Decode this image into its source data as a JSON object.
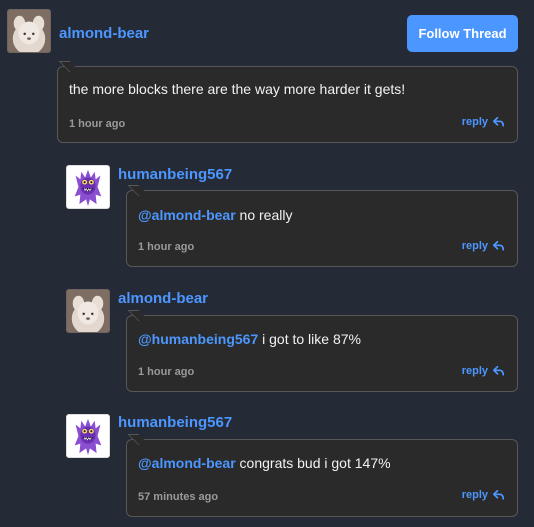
{
  "thread": {
    "follow_label": "Follow Thread"
  },
  "comments": [
    {
      "author": "almond-bear",
      "mention": "",
      "text": "the more blocks there are the way more harder it gets!",
      "time": "1 hour ago",
      "reply_label": "reply"
    },
    {
      "author": "humanbeing567",
      "mention": "@almond-bear",
      "text": " no really",
      "time": "1 hour ago",
      "reply_label": "reply"
    },
    {
      "author": "almond-bear",
      "mention": "@humanbeing567",
      "text": " i got to like 87%",
      "time": "1 hour ago",
      "reply_label": "reply"
    },
    {
      "author": "humanbeing567",
      "mention": "@almond-bear",
      "text": " congrats bud i got 147%",
      "time": "57 minutes ago",
      "reply_label": "reply"
    }
  ],
  "colors": {
    "background": "#252a37",
    "accent": "#4c97ff",
    "bubble": "#2a2a2a",
    "bubble_border": "#575757",
    "timestamp": "#9a9a9a"
  },
  "icons": {
    "reply": "reply-arrow-icon",
    "bear_avatar": "bear-avatar",
    "human_avatar": "purple-monster-avatar"
  }
}
